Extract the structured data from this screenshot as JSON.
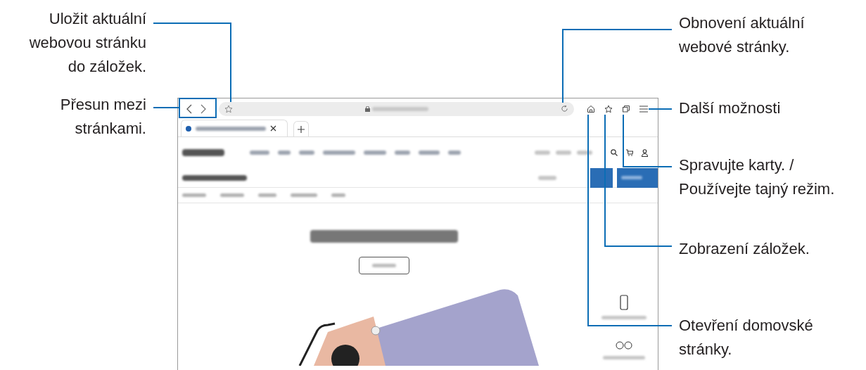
{
  "callouts": [
    {
      "text": "Uložit aktuální\nwebovou stránku\ndo záložek."
    },
    {
      "text": "Přesun mezi\nstránkami."
    },
    {
      "text": "Obnovení aktuální\nwebové stránky."
    },
    {
      "text": "Další možnosti"
    },
    {
      "text": "Spravujte karty. /\nPoužívejte tajný režim."
    },
    {
      "text": "Zobrazení záložek."
    },
    {
      "text": "Otevření domovské\nstránky."
    }
  ]
}
